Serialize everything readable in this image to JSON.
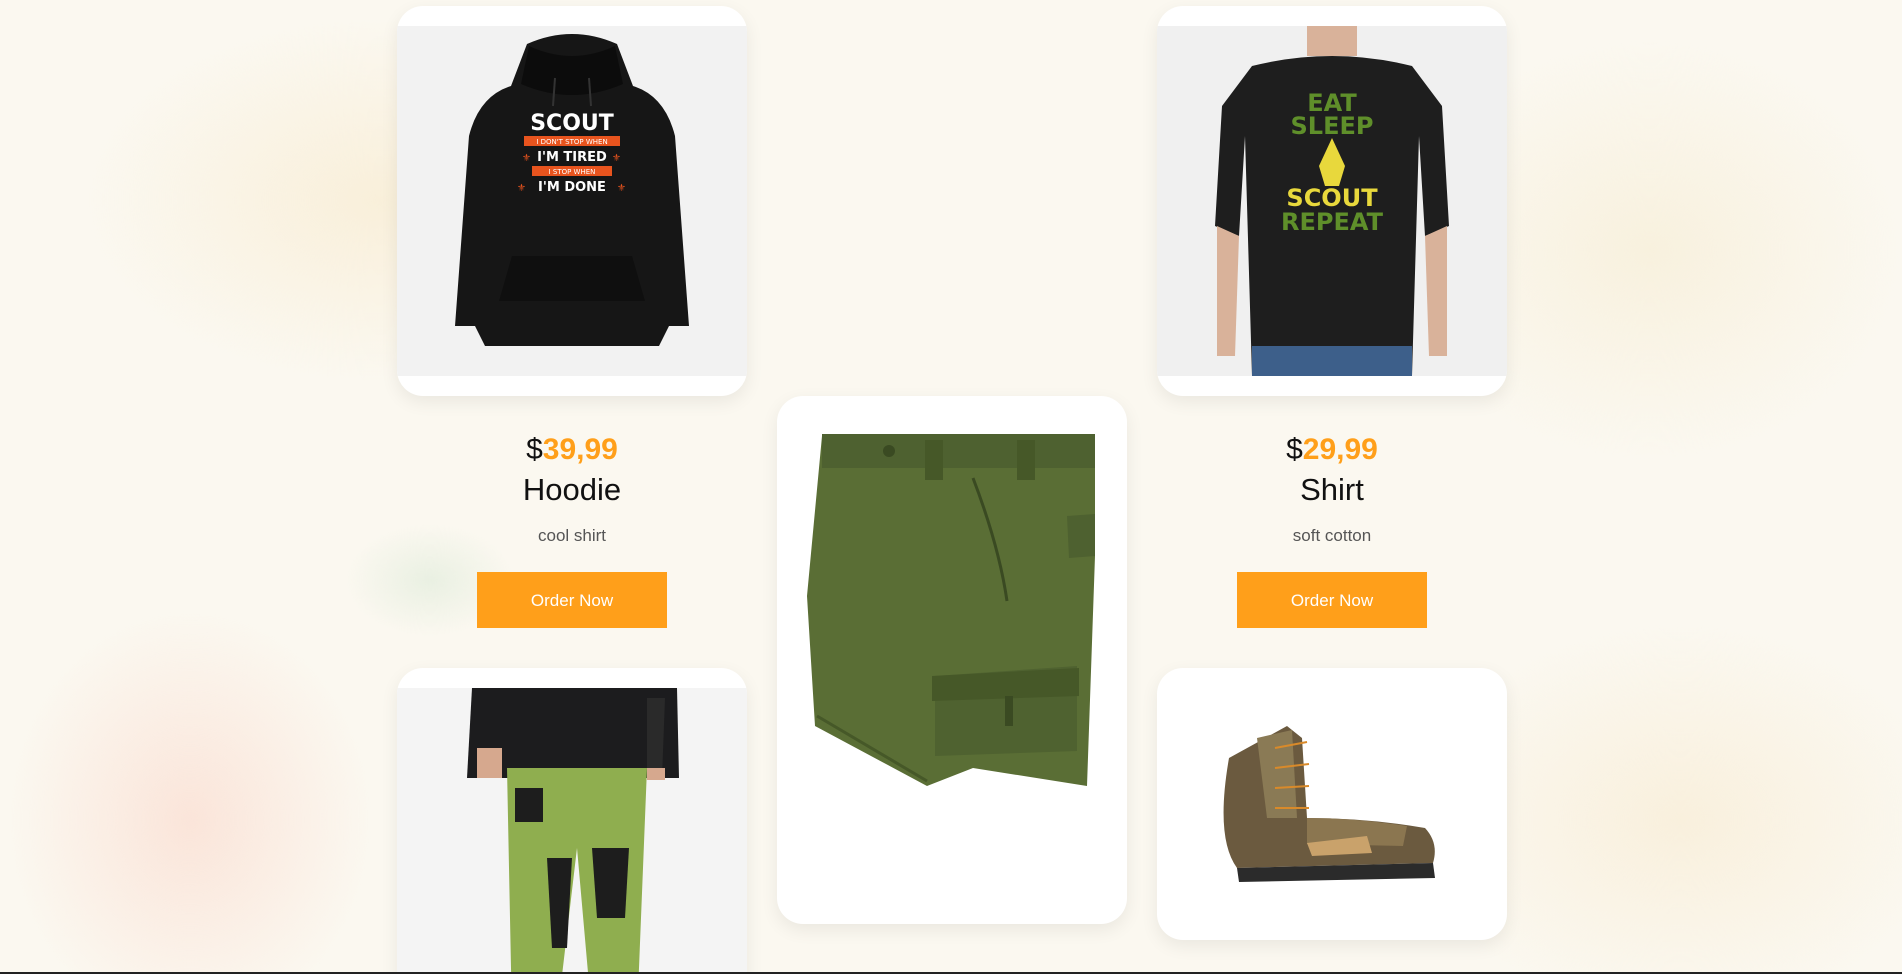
{
  "products": [
    {
      "price_symbol": "$",
      "price_amount": "39,99",
      "name": "Hoodie",
      "desc": "cool shirt",
      "cta": "Order Now",
      "image": "black-scout-hoodie"
    },
    {
      "price_symbol": "$",
      "price_amount": "29,99",
      "name": "Shirt",
      "desc": "soft cotton",
      "cta": "Order Now",
      "image": "black-eat-sleep-scout-repeat-tshirt"
    }
  ],
  "hoodie_print": {
    "line1": "SCOUT",
    "line2": "I DON'T STOP WHEN",
    "line3": "I'M TIRED",
    "line4": "I STOP WHEN",
    "line5": "I'M DONE"
  },
  "shirt_print": {
    "line1": "EAT",
    "line2": "SLEEP",
    "line3": "SCOUT",
    "line4": "REPEAT"
  },
  "more_images": [
    "green-cargo-shorts",
    "green-hiking-pants",
    "brown-hiking-boot"
  ],
  "colors": {
    "accent": "#ff9f1a",
    "text": "#111111",
    "muted": "#555555"
  }
}
